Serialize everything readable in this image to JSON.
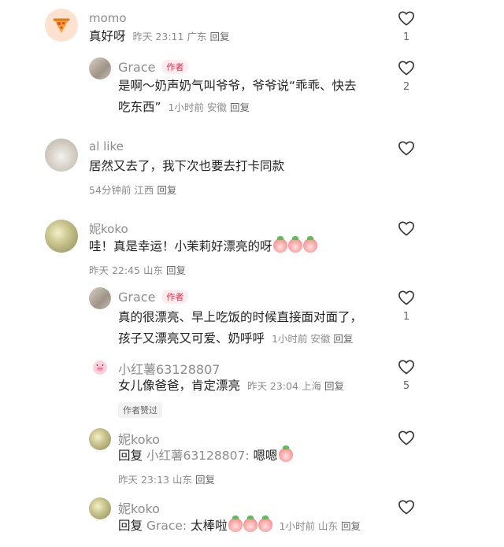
{
  "comments": [
    {
      "name": "momo",
      "text": "真好呀",
      "time": "昨天 23:11",
      "location": "广东",
      "reply": "回复",
      "likes": "1"
    },
    {
      "name": "Grace",
      "author_tag": "作者",
      "text_line1": "是啊～奶声奶气叫爷爷，爷爷说“乖乖、快去",
      "text_line2": "吃东西”",
      "time": "1小时前",
      "location": "安徽",
      "reply": "回复",
      "likes": "2"
    },
    {
      "name": "al like",
      "text": "居然又去了，我下次也要去打卡同款",
      "time": "54分钟前",
      "location": "江西",
      "reply": "回复",
      "likes": ""
    },
    {
      "name": "妮koko",
      "text": "哇！真是幸运！小茉莉好漂亮的呀",
      "time": "昨天 22:45",
      "location": "山东",
      "reply": "回复",
      "likes": ""
    },
    {
      "name": "Grace",
      "author_tag": "作者",
      "text_line1": "真的很漂亮、早上吃饭的时候直接面对面了，",
      "text_line2": "孩子又漂亮又可爱、奶呼呼",
      "time": "1小时前",
      "location": "安徽",
      "reply": "回复",
      "likes": "1"
    },
    {
      "name": "小红薯63128807",
      "text": "女儿像爸爸，肯定漂亮",
      "time": "昨天 23:04",
      "location": "上海",
      "reply": "回复",
      "likes": "5",
      "badge": "作者赞过"
    },
    {
      "name": "妮koko",
      "reply_prefix": "回复",
      "reply_to": "小红薯63128807:",
      "text": "嗯嗯",
      "time": "昨天 23:13",
      "location": "山东",
      "reply": "回复",
      "likes": ""
    },
    {
      "name": "妮koko",
      "reply_prefix": "回复",
      "reply_to": "Grace:",
      "text": "太棒啦",
      "time": "1小时前",
      "location": "山东",
      "reply": "回复",
      "likes": ""
    }
  ],
  "icons": {
    "like": "heart-outline-icon",
    "sticker": "peach-face-emoji"
  },
  "colors": {
    "author_tag": "#ff2442",
    "meta_text": "#8c8c8c"
  }
}
